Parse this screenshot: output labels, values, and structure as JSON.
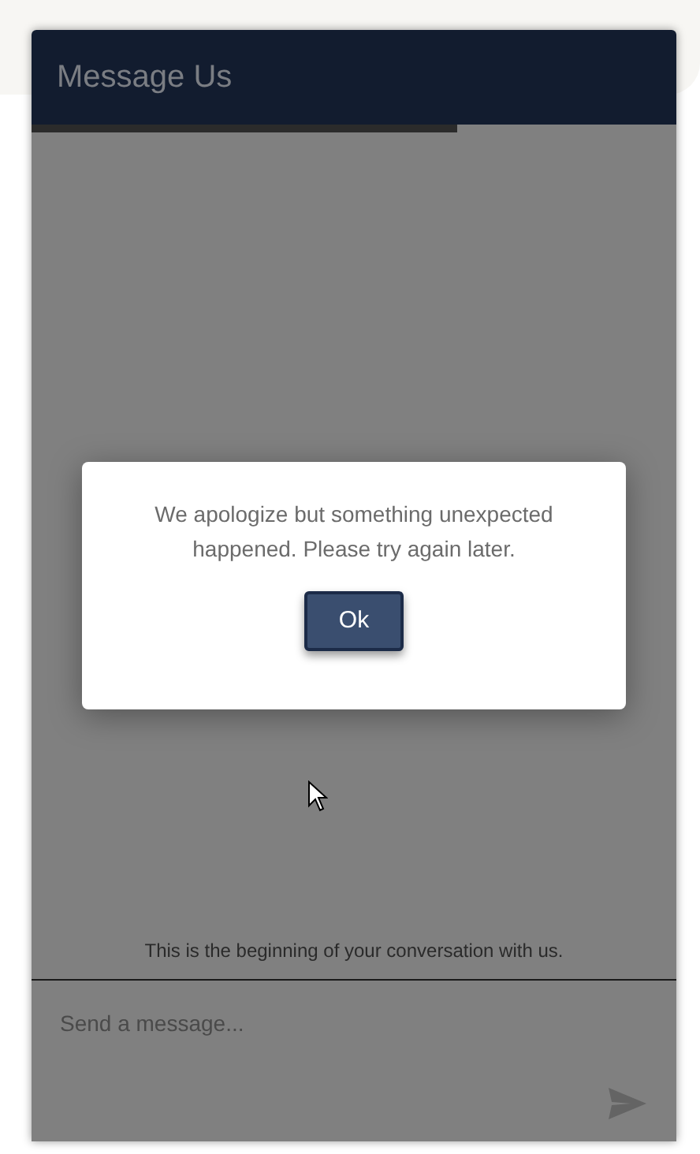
{
  "window": {
    "title": "Message Us"
  },
  "progress": {
    "level": 0.66
  },
  "conversation": {
    "notice": "This is the beginning of your conversation with us."
  },
  "composer": {
    "placeholder": "Send a message..."
  },
  "dialog": {
    "message": "We apologize but something unexpected happened. Please try again later.",
    "button": "Ok"
  }
}
